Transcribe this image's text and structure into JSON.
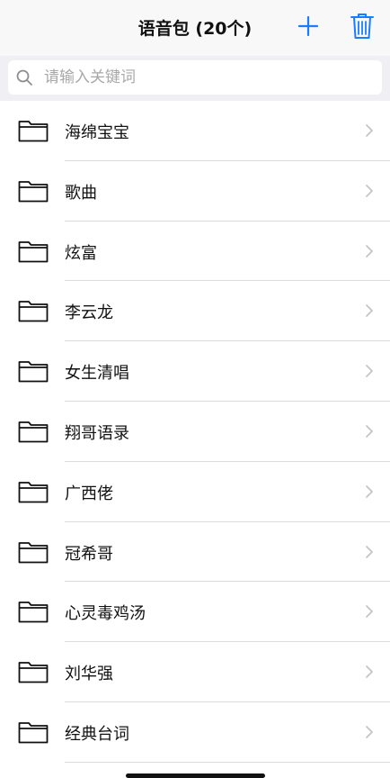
{
  "header": {
    "title": "语音包 (20个)",
    "accent_color": "#1a7dff"
  },
  "search": {
    "placeholder": "请输入关键词",
    "value": ""
  },
  "list": {
    "items": [
      {
        "label": "海绵宝宝"
      },
      {
        "label": "歌曲"
      },
      {
        "label": "炫富"
      },
      {
        "label": "李云龙"
      },
      {
        "label": "女生清唱"
      },
      {
        "label": "翔哥语录"
      },
      {
        "label": "广西佬"
      },
      {
        "label": "冠希哥"
      },
      {
        "label": "心灵毒鸡汤"
      },
      {
        "label": "刘华强"
      },
      {
        "label": "经典台词"
      }
    ]
  },
  "icons": {
    "add": "plus-icon",
    "delete": "trash-icon",
    "search": "search-icon",
    "folder": "folder-icon",
    "chevron": "chevron-right-icon"
  }
}
